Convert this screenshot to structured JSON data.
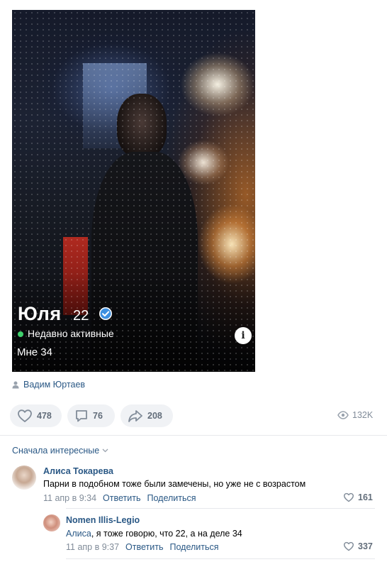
{
  "post": {
    "photo": {
      "name": "Юля",
      "age": "22",
      "status": "Недавно активные",
      "bio": "Мне 34",
      "info_glyph": "i"
    },
    "author": "Вадим Юртаев",
    "actions": {
      "likes": "478",
      "comments": "76",
      "shares": "208",
      "views": "132K"
    }
  },
  "comments": {
    "sort_label": "Сначала интересные",
    "items": [
      {
        "author": "Алиса Токарева",
        "text": "Парни в подобном тоже были замечены, но уже не с возрастом",
        "date": "11 апр в 9:34",
        "reply_label": "Ответить",
        "share_label": "Поделиться",
        "likes": "161"
      },
      {
        "author": "Nomen Illis-Legio",
        "reply_to": "Алиса",
        "text": ", я тоже говорю, что 22, а на деле 34",
        "date": "11 апр в 9:37",
        "reply_label": "Ответить",
        "share_label": "Поделиться",
        "likes": "337"
      }
    ]
  },
  "colors": {
    "link": "#2a5885",
    "muted": "#818c99",
    "pill_bg": "#f0f2f5",
    "active_green": "#3fd16c",
    "verified_blue": "#3d8fe0"
  },
  "icons": [
    "verified-icon",
    "info-icon",
    "user-icon",
    "heart-icon",
    "comment-icon",
    "share-icon",
    "eye-icon",
    "chevron-down-icon"
  ]
}
